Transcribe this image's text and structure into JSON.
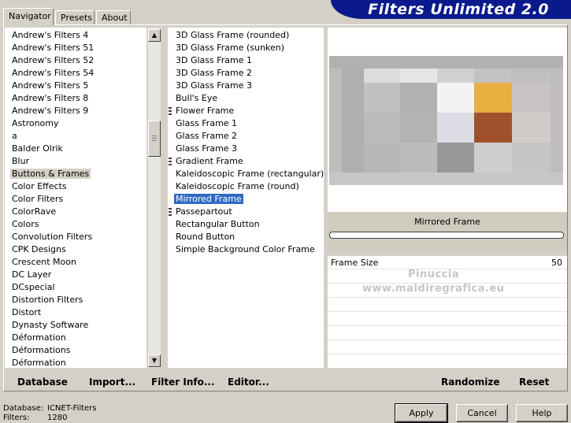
{
  "tabs": [
    "Navigator",
    "Presets",
    "About"
  ],
  "app_title": "Filters Unlimited 2.0",
  "categories": [
    "Andrew's Filters 4",
    "Andrew's Filters 51",
    "Andrew's Filters 52",
    "Andrew's Filters 54",
    "Andrew's Filters 5",
    "Andrew's Filters 8",
    "Andrew's Filters 9",
    "Astronomy",
    "a",
    "Balder Olrik",
    "Blur",
    "Buttons & Frames",
    "Color Effects",
    "Color Filters",
    "ColorRave",
    "Colors",
    "Convolution Filters",
    "CPK Designs",
    "Crescent Moon",
    "DC Layer",
    "DCspecial",
    "Distortion Filters",
    "Distort",
    "Dynasty Software",
    "Déformation",
    "Déformations",
    "Déformation"
  ],
  "selected_category": "Buttons & Frames",
  "filters": [
    {
      "label": "3D Glass Frame (rounded)",
      "grip": false
    },
    {
      "label": "3D Glass Frame (sunken)",
      "grip": false
    },
    {
      "label": "3D Glass Frame 1",
      "grip": false
    },
    {
      "label": "3D Glass Frame 2",
      "grip": false
    },
    {
      "label": "3D Glass Frame 3",
      "grip": false
    },
    {
      "label": "Bull's Eye",
      "grip": false
    },
    {
      "label": "Flower Frame",
      "grip": true
    },
    {
      "label": "Glass Frame 1",
      "grip": false
    },
    {
      "label": "Glass Frame 2",
      "grip": false
    },
    {
      "label": "Glass Frame 3",
      "grip": false
    },
    {
      "label": "Gradient Frame",
      "grip": true
    },
    {
      "label": "Kaleidoscopic Frame (rectangular)",
      "grip": false
    },
    {
      "label": "Kaleidoscopic Frame (round)",
      "grip": false
    },
    {
      "label": "Mirrored Frame",
      "grip": false
    },
    {
      "label": "Passepartout",
      "grip": true
    },
    {
      "label": "Rectangular Button",
      "grip": false
    },
    {
      "label": "Round Button",
      "grip": false
    },
    {
      "label": "Simple Background Color Frame",
      "grip": false
    }
  ],
  "selected_filter": "Mirrored Frame",
  "preview": {
    "filter_name": "Mirrored Frame",
    "colors": {
      "orange": "#e8b040",
      "rust": "#a0502a",
      "white": "#f2f2f4",
      "gray": "#a8a6a6"
    }
  },
  "params": [
    {
      "label": "Frame Size",
      "value": "50"
    }
  ],
  "watermark": [
    "Pinuccia",
    "www.maidiregrafica.eu"
  ],
  "toolbar": {
    "database": "Database",
    "import": "Import...",
    "filter_info": "Filter Info...",
    "editor": "Editor...",
    "randomize": "Randomize",
    "reset": "Reset"
  },
  "status": {
    "database_label": "Database:",
    "database_value": "ICNET-Filters",
    "filters_label": "Filters:",
    "filters_value": "1280"
  },
  "buttons": {
    "apply": "Apply",
    "cancel": "Cancel",
    "help": "Help"
  }
}
